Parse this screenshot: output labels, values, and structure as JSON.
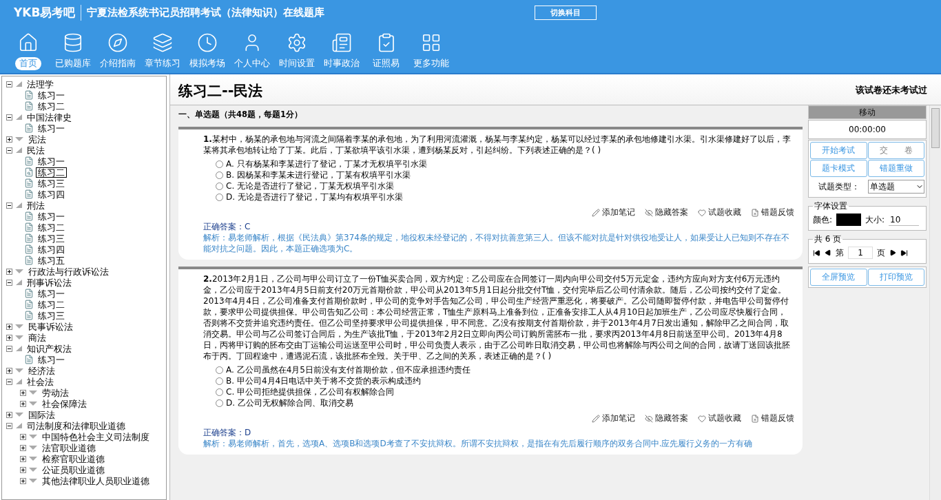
{
  "header": {
    "logo": "YKB易考吧",
    "title": "宁夏法检系统书记员招聘考试（法律知识）在线题库",
    "switch_button": "切换科目"
  },
  "nav": [
    {
      "label": "首页",
      "selected": true
    },
    {
      "label": "已购题库",
      "selected": false
    },
    {
      "label": "介绍指南",
      "selected": false
    },
    {
      "label": "章节练习",
      "selected": false
    },
    {
      "label": "模拟考场",
      "selected": false
    },
    {
      "label": "个人中心",
      "selected": false
    },
    {
      "label": "时间设置",
      "selected": false
    },
    {
      "label": "时事政治",
      "selected": false
    },
    {
      "label": "证照易",
      "selected": false
    },
    {
      "label": "更多功能",
      "selected": false
    }
  ],
  "tree": [
    {
      "label": "法理学",
      "expanded": true,
      "children": [
        {
          "label": "练习一",
          "selected": false
        },
        {
          "label": "练习二",
          "selected": false
        }
      ]
    },
    {
      "label": "中国法律史",
      "expanded": true,
      "children": [
        {
          "label": "练习一",
          "selected": false
        }
      ]
    },
    {
      "label": "宪法",
      "expanded": false
    },
    {
      "label": "民法",
      "expanded": true,
      "children": [
        {
          "label": "练习一",
          "selected": false
        },
        {
          "label": "练习二",
          "selected": true
        },
        {
          "label": "练习三",
          "selected": false
        },
        {
          "label": "练习四",
          "selected": false
        }
      ]
    },
    {
      "label": "刑法",
      "expanded": true,
      "children": [
        {
          "label": "练习一",
          "selected": false
        },
        {
          "label": "练习二",
          "selected": false
        },
        {
          "label": "练习三",
          "selected": false
        },
        {
          "label": "练习四",
          "selected": false
        },
        {
          "label": "练习五",
          "selected": false
        }
      ]
    },
    {
      "label": "行政法与行政诉讼法",
      "expanded": false
    },
    {
      "label": "刑事诉讼法",
      "expanded": true,
      "children": [
        {
          "label": "练习一",
          "selected": false
        },
        {
          "label": "练习二",
          "selected": false
        },
        {
          "label": "练习三",
          "selected": false
        }
      ]
    },
    {
      "label": "民事诉讼法",
      "expanded": false
    },
    {
      "label": "商法",
      "expanded": false
    },
    {
      "label": "知识产权法",
      "expanded": true,
      "children": [
        {
          "label": "练习一",
          "selected": false
        }
      ]
    },
    {
      "label": "经济法",
      "expanded": false
    },
    {
      "label": "社会法",
      "expanded": true,
      "children": [
        {
          "label": "劳动法",
          "expanded": false
        },
        {
          "label": "社会保障法",
          "expanded": false
        }
      ]
    },
    {
      "label": "国际法",
      "expanded": false
    },
    {
      "label": "司法制度和法律职业道德",
      "expanded": true,
      "children": [
        {
          "label": "中国特色社会主义司法制度",
          "expanded": false
        },
        {
          "label": "法官职业道德",
          "expanded": false
        },
        {
          "label": "检察官职业道德",
          "expanded": false
        },
        {
          "label": "公证员职业道德",
          "expanded": false
        },
        {
          "label": "其他法律职业人员职业道德",
          "expanded": false
        }
      ]
    }
  ],
  "paper": {
    "title": "练习二--民法",
    "status": "该试卷还未考试过",
    "section": "一、单选题（共48题，每题1分）"
  },
  "questions": [
    {
      "number": "1.",
      "stem": "某村中，杨某的承包地与河流之间隔着李某的承包地，为了利用河流灌溉，杨某与李某约定，杨某可以经过李某的承包地修建引水渠。引水渠修建好了以后，李某将其承包地转让给了丁某。此后，丁某欲填平该引水渠，遭到杨某反对，引起纠纷。下列表述正确的是？( )",
      "actions": [
        "添加笔记",
        "隐藏答案",
        "试题收藏",
        "错题反馈"
      ],
      "options": [
        {
          "letter": "A.",
          "text": "只有杨某和李某进行了登记，丁某才无权填平引水渠",
          "selected": false
        },
        {
          "letter": "B.",
          "text": "因杨某和李某未进行登记，丁某有权填平引水渠",
          "selected": false
        },
        {
          "letter": "C.",
          "text": "无论是否进行了登记，丁某无权填平引水渠",
          "selected": false
        },
        {
          "letter": "D.",
          "text": "无论是否进行了登记，丁某均有权填平引水渠",
          "selected": false
        }
      ],
      "answer": "正确答案：C",
      "analysis": "解析：易老师解析，根据《民法典》第374条的规定，地役权未经登记的，不得对抗善意第三人。但该不能对抗是针对供役地受让人，如果受让人已知则不存在不能对抗之问题。因此，本题正确选项为C。"
    },
    {
      "number": "2.",
      "stem": "2013年2月1日，乙公司与甲公司订立了一份T恤买卖合同，双方约定：乙公司应在合同签订一周内向甲公司交付5万元定金，违约方应向对方支付6万元违约金，乙公司应于2013年4月5日前支付20万元首期价款，甲公司从2013年5月1日起分批交付T恤，交付完毕后乙公司付清余款。随后，乙公司按约交付了定金。2013年4月4日，乙公司准备支付首期价款时，甲公司的竞争对手告知乙公司，甲公司生产经营严重恶化，将要破产。乙公司随即暂停付款，并电告甲公司暂停付款，要求甲公司提供担保。甲公司告知乙公司：本公司经营正常，T恤生产原料马上准备到位，正准备安排工人从4月10日起加班生产，乙公司应尽快履行合同，否则将不交货并追究违约责任。但乙公司坚持要求甲公司提供担保，甲不同意。乙没有按期支付首期价款，并于2013年4月7日发出通知，解除甲乙之间合同，取消交易。甲公司与乙公司签订合同后，为生产该批T恤，于2013年2月2日立即向丙公司订购所需胚布一批，要求丙2013年4月8日前送至甲公司。2013年4月8日，丙将甲订购的胚布交由丁运输公司运送至甲公司时，甲公司负责人表示，由于乙公司昨日取消交易，甲公司也将解除与丙公司之间的合同，故请丁送回该批胚布于丙。丁回程途中，遭遇泥石流，该批胚布全毁。关于甲、乙之间的关系，表述正确的是？( )",
      "actions": [
        "添加笔记",
        "隐藏答案",
        "试题收藏",
        "错题反馈"
      ],
      "options": [
        {
          "letter": "A.",
          "text": "乙公司虽然在4月5日前没有支付首期价款，但不应承担违约责任",
          "selected": false
        },
        {
          "letter": "B.",
          "text": "甲公司4月4日电话中关于将不交货的表示构成违约",
          "selected": false
        },
        {
          "letter": "C.",
          "text": "甲公司拒绝提供担保，乙公司有权解除合同",
          "selected": false
        },
        {
          "letter": "D.",
          "text": "乙公司无权解除合同、取消交易",
          "selected": false
        }
      ],
      "answer": "正确答案：D",
      "analysis": "解析：易老师解析，首先，选项A、选项B和选项D考查了不安抗辩权。所谓不安抗辩权，是指在有先后履行顺序的双务合同中.应先履行义务的一方有确"
    }
  ],
  "panel": {
    "header": "移动",
    "timer": "00:00:00",
    "buttons": [
      {
        "label": "开始考试",
        "disabled": false
      },
      {
        "label": "交　　卷",
        "disabled": true
      },
      {
        "label": "题卡模式",
        "disabled": false
      },
      {
        "label": "错题重做",
        "disabled": false
      }
    ],
    "type_label": "试题类型：",
    "type_value": "单选题",
    "font_legend": "字体设置",
    "color_label": "颜色:",
    "color": "#000000",
    "size_label": "大小:",
    "size_value": "10",
    "pages_legend": "共 6 页",
    "page_prefix": "第",
    "page_value": "1",
    "page_suffix": "页",
    "preview_buttons": [
      "全屏预览",
      "打印预览"
    ]
  }
}
